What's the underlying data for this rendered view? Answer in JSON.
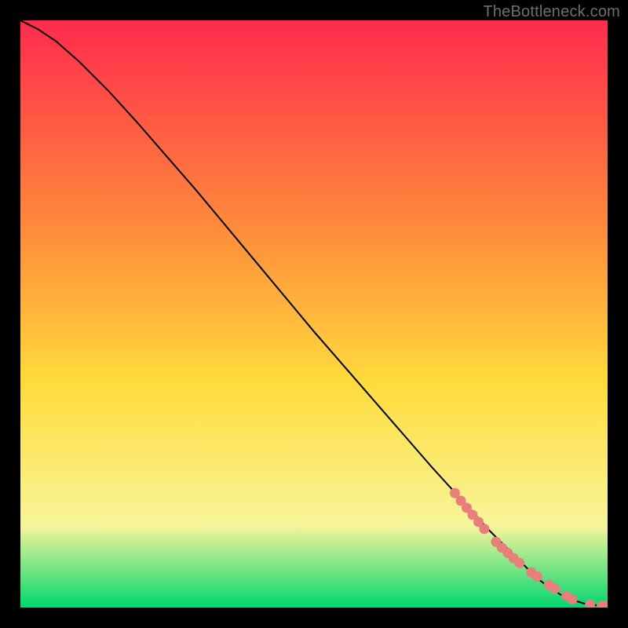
{
  "attribution": "TheBottleneck.com",
  "colors": {
    "background": "#000000",
    "gradient_top": "#ff2b4d",
    "gradient_mid1": "#ff8a3a",
    "gradient_mid2": "#ffdc3c",
    "gradient_mid3": "#f7f59a",
    "gradient_bottom": "#00d770",
    "curve": "#000000",
    "marker": "#e87f7a"
  },
  "chart_data": {
    "type": "line",
    "title": "",
    "xlabel": "",
    "ylabel": "",
    "xlim": [
      0,
      100
    ],
    "ylim": [
      0,
      100
    ],
    "series": [
      {
        "name": "curve",
        "x": [
          0,
          3,
          6,
          10,
          15,
          20,
          30,
          40,
          50,
          60,
          70,
          75,
          80,
          85,
          88,
          90,
          92,
          94,
          96,
          98,
          100
        ],
        "y": [
          100,
          98.5,
          96.5,
          93,
          88,
          82.5,
          71,
          59,
          47,
          35.5,
          24,
          18.5,
          13,
          8,
          5,
          3.5,
          2.2,
          1.3,
          0.7,
          0.4,
          0.3
        ]
      }
    ],
    "markers": [
      {
        "x": 74,
        "y": 19.5
      },
      {
        "x": 75,
        "y": 18.2
      },
      {
        "x": 76,
        "y": 17.0
      },
      {
        "x": 77,
        "y": 15.8
      },
      {
        "x": 78,
        "y": 14.6
      },
      {
        "x": 79,
        "y": 13.4
      },
      {
        "x": 81,
        "y": 11.2
      },
      {
        "x": 82,
        "y": 10.2
      },
      {
        "x": 83,
        "y": 9.3
      },
      {
        "x": 84,
        "y": 8.4
      },
      {
        "x": 85,
        "y": 7.6
      },
      {
        "x": 87,
        "y": 6.0
      },
      {
        "x": 88,
        "y": 5.3
      },
      {
        "x": 90,
        "y": 3.9
      },
      {
        "x": 91,
        "y": 3.2
      },
      {
        "x": 93,
        "y": 2.0
      },
      {
        "x": 94,
        "y": 1.4
      },
      {
        "x": 97,
        "y": 0.5
      },
      {
        "x": 99,
        "y": 0.3
      },
      {
        "x": 100,
        "y": 0.3
      }
    ]
  }
}
